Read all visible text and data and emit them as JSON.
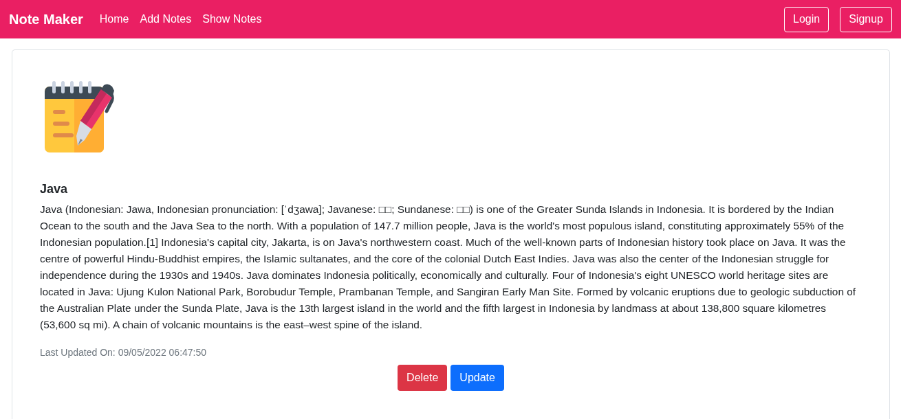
{
  "navbar": {
    "brand": "Note Maker",
    "links": [
      "Home",
      "Add Notes",
      "Show Notes"
    ],
    "buttons": [
      "Login",
      "Signup"
    ]
  },
  "note": {
    "title": "Java",
    "body": "Java (Indonesian: Jawa, Indonesian pronunciation: [ˈdʒawa]; Javanese: □□; Sundanese: □□) is one of the Greater Sunda Islands in Indonesia. It is bordered by the Indian Ocean to the south and the Java Sea to the north. With a population of 147.7 million people, Java is the world's most populous island, constituting approximately 55% of the Indonesian population.[1] Indonesia's capital city, Jakarta, is on Java's northwestern coast. Much of the well-known parts of Indonesian history took place on Java. It was the centre of powerful Hindu-Buddhist empires, the Islamic sultanates, and the core of the colonial Dutch East Indies. Java was also the center of the Indonesian struggle for independence during the 1930s and 1940s. Java dominates Indonesia politically, economically and culturally. Four of Indonesia's eight UNESCO world heritage sites are located in Java: Ujung Kulon National Park, Borobudur Temple, Prambanan Temple, and Sangiran Early Man Site. Formed by volcanic eruptions due to geologic subduction of the Australian Plate under the Sunda Plate, Java is the 13th largest island in the world and the fifth largest in Indonesia by landmass at about 138,800 square kilometres (53,600 sq mi). A chain of volcanic mountains is the east–west spine of the island.",
    "last_updated": "Last Updated On: 09/05/2022 06:47:50",
    "buttons": [
      {
        "label": "Delete",
        "kind": "danger"
      },
      {
        "label": "Update",
        "kind": "primary"
      }
    ]
  }
}
